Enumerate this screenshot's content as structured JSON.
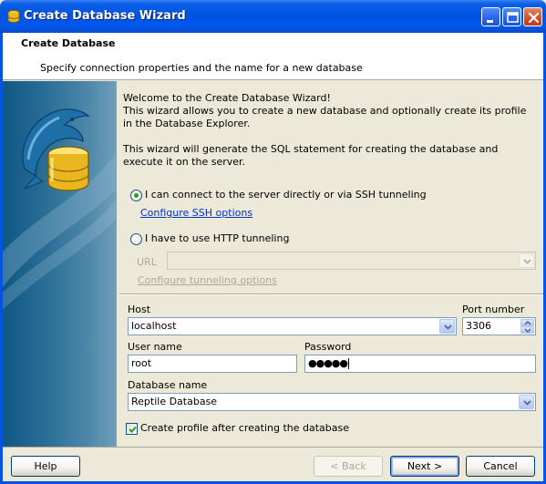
{
  "window": {
    "title": "Create Database Wizard"
  },
  "header": {
    "title": "Create Database",
    "subtitle": "Specify connection properties and the name for a new database"
  },
  "intro": {
    "line1": "Welcome to the Create Database Wizard!",
    "line2": "This wizard allows you to create a new database and optionally create its profile in the Database Explorer.",
    "line3": "This wizard will generate the SQL statement for creating the database and execute it on the server."
  },
  "connection": {
    "direct_label": "I can connect to the server directly or via SSH tunneling",
    "direct_selected": true,
    "ssh_link": "Configure SSH options",
    "http_label": "I have to use HTTP tunneling",
    "http_selected": false,
    "url_label": "URL",
    "url_value": "",
    "tunneling_link": "Configure tunneling options"
  },
  "fields": {
    "host_label": "Host",
    "host_value": "localhost",
    "port_label": "Port number",
    "port_value": "3306",
    "user_label": "User name",
    "user_value": "root",
    "password_label": "Password",
    "password_value": "●●●●●",
    "dbname_label": "Database name",
    "dbname_value": "Reptile Database"
  },
  "profile": {
    "label": "Create profile after creating the database",
    "checked": true
  },
  "buttons": {
    "help": "Help",
    "back": "< Back",
    "next": "Next >",
    "cancel": "Cancel"
  },
  "colors": {
    "titlebar": "#0053E1",
    "link": "#0033CC",
    "radio_dot": "#21A121",
    "side_panel": "#2B6F97"
  }
}
